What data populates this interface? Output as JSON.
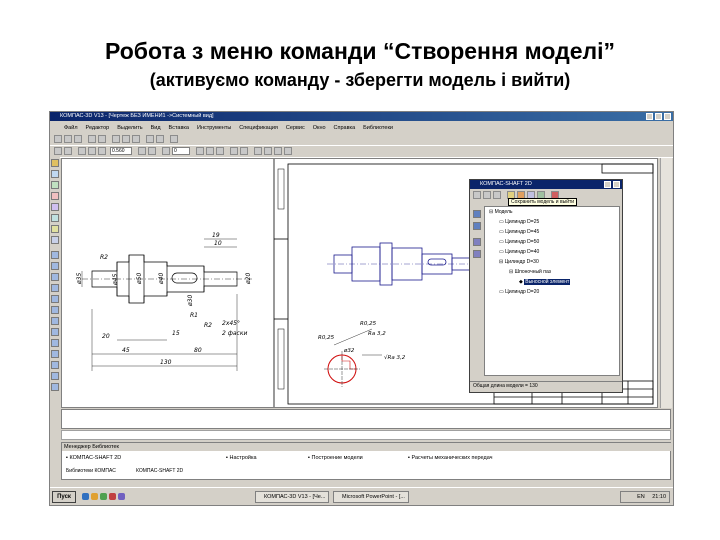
{
  "slide": {
    "title": "Робота з меню команди “Створення моделі”",
    "subtitle": "(активуємо команду - зберегти модель і вийти)"
  },
  "window": {
    "title": "КОМПАС-3D V13 - [Чертеж БЕЗ ИМЕНИ1 ->Системный вид]"
  },
  "menu": [
    "Файл",
    "Редактор",
    "Выделить",
    "Вид",
    "Вставка",
    "Инструменты",
    "Спецификация",
    "Сервис",
    "Окно",
    "Справка",
    "Библиотеки"
  ],
  "toolbar": {
    "scale_value": "0.560",
    "layer_value": "0"
  },
  "drawing": {
    "dims_left": [
      "R2",
      "ø35",
      "ø45",
      "ø50",
      "ø40",
      "ø30",
      "ø20",
      "R2",
      "R1",
      "19",
      "10",
      "2x45°",
      "2 фаски",
      "20",
      "45",
      "80",
      "130",
      "15"
    ],
    "dims_right": [
      "R0,25",
      "ø32",
      "R0,25",
      "√Ra 3,2",
      "Ra 3,2"
    ]
  },
  "shaft": {
    "window_title": "КОМПАС-SHAFT 2D",
    "tooltip": "Сохранить модель и выйти",
    "tree": [
      {
        "label": "Модель",
        "level": 0
      },
      {
        "label": "Цилиндр  D=25",
        "level": 1
      },
      {
        "label": "Цилиндр  D=45",
        "level": 1
      },
      {
        "label": "Цилиндр  D=50",
        "level": 1
      },
      {
        "label": "Цилиндр  D=40",
        "level": 1
      },
      {
        "label": "Цилиндр  D=30",
        "level": 1
      },
      {
        "label": "Шпоночный паз",
        "level": 2
      },
      {
        "label": "Выносной элемент",
        "level": 3,
        "selected": true
      },
      {
        "label": "Цилиндр  D=20",
        "level": 1
      }
    ],
    "status": "Общая длина модели = 130"
  },
  "libmgr": {
    "title": "Менеджер Библиотек",
    "rows": [
      {
        "name": "КОМПАС-SHAFT 2D"
      },
      {
        "name": "Настройка"
      },
      {
        "name": "Построение модели"
      },
      {
        "name": "Расчеты механических передач"
      }
    ],
    "tabs": [
      "Библиотеки КОМПАС",
      "КОМПАС-SHAFT 2D"
    ]
  },
  "taskbar": {
    "start": "Пуск",
    "buttons": [
      "КОМПАС-3D V13 - [Че...",
      "Microsoft PowerPoint - [..."
    ],
    "lang": "EN",
    "time": "21:10"
  },
  "colors": {
    "title_bar": "#0a246a",
    "drawing_line": "#1a1a8c",
    "accent_red": "#d01010"
  }
}
